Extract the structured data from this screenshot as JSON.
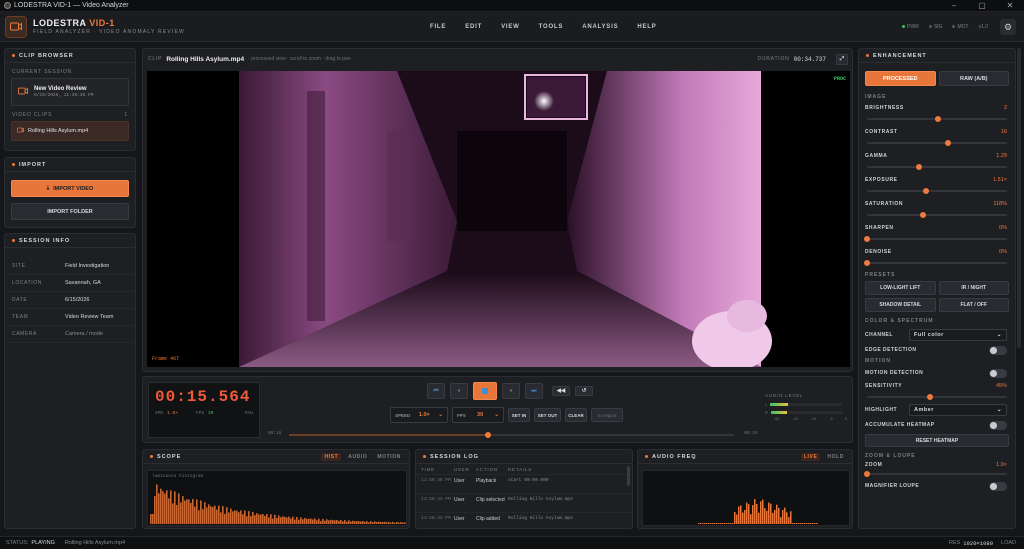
{
  "window": {
    "title": "LODESTRA VID-1 — Video Analyzer"
  },
  "brand": {
    "name": "LODESTRA",
    "model": "VID-1",
    "tagline": "FIELD ANALYZER · VIDEO ANOMALY REVIEW"
  },
  "menu": [
    "FILE",
    "EDIT",
    "VIEW",
    "TOOLS",
    "ANALYSIS",
    "HELP"
  ],
  "indicators": {
    "pwr": "PWR",
    "sig": "SIG",
    "mot": "MOT",
    "version": "v1.0"
  },
  "clip_browser": {
    "title": "CLIP BROWSER",
    "session_label": "CURRENT SESSION",
    "session_name": "New Video Review",
    "session_time": "6/15/2026, 11:36:35 PM",
    "clips_label": "VIDEO CLIPS",
    "clips_count": "1",
    "clips": [
      "Rolling Hills Asylum.mp4"
    ]
  },
  "import": {
    "title": "IMPORT",
    "import_video": "IMPORT VIDEO",
    "import_folder": "IMPORT FOLDER"
  },
  "session_info": {
    "title": "SESSION INFO",
    "rows": [
      {
        "key": "SITE",
        "value": "Field Investigation"
      },
      {
        "key": "LOCATION",
        "value": "Savannah, GA"
      },
      {
        "key": "DATE",
        "value": "6/15/2026"
      },
      {
        "key": "TEAM",
        "value": "Video Review Team"
      },
      {
        "key": "CAMERA",
        "value": "Camera / mode"
      }
    ]
  },
  "video": {
    "clip_label": "CLIP",
    "clip_name": "Rolling Hills Asylum.mp4",
    "hint": "· processed view · scroll to zoom · drag to pan",
    "duration_label": "DURATION",
    "duration": "00:34.737",
    "proc_badge": "PROC",
    "frame_label": "Frame 467"
  },
  "transport": {
    "timecode": "00:15.564",
    "spd_label": "SPD",
    "spd_value": "1.0×",
    "fps_label": "FPS",
    "fps_value": "30",
    "paused_label": "PAU",
    "speed_label": "SPEED",
    "speed_value": "1.0×",
    "fps_select_label": "FPS",
    "fps_select_value": "30",
    "set_in": "SET IN",
    "set_out": "SET OUT",
    "clear": "CLEAR",
    "no_region": "no region",
    "start_time": "00:15",
    "end_time": "00:34",
    "progress": 0.448,
    "audio_level_label": "AUDIO LEVEL",
    "level_l": "L",
    "level_r": "R",
    "level_l_value": 0.24,
    "level_r_value": 0.22,
    "db_ticks": [
      "-60",
      "-40",
      "-20",
      "-6",
      "0"
    ]
  },
  "scope": {
    "title": "SCOPE",
    "tabs": [
      "HIST",
      "AUDIO",
      "MOTION"
    ],
    "active_tab": "HIST",
    "caption": "luminance histogram"
  },
  "session_log": {
    "title": "SESSION LOG",
    "columns": [
      "TIME",
      "USER",
      "ACTION",
      "DETAILS"
    ],
    "rows": [
      {
        "time": "11:56:46 PM",
        "user": "User",
        "action": "Playback",
        "details": "start 00:00.000"
      },
      {
        "time": "11:56:43 PM",
        "user": "User",
        "action": "Clip selected",
        "details": "Rolling Hills Asylum.mp4"
      },
      {
        "time": "11:56:43 PM",
        "user": "User",
        "action": "Clip added",
        "details": "Rolling Hills Asylum.mp4"
      }
    ]
  },
  "audio_freq": {
    "title": "AUDIO FREQ",
    "tabs": [
      "LIVE",
      "HOLD"
    ],
    "active_tab": "LIVE"
  },
  "enhancement": {
    "title": "ENHANCEMENT",
    "mode_processed": "PROCESSED",
    "mode_raw": "RAW (A/B)",
    "image_label": "IMAGE",
    "sliders": [
      {
        "name": "BRIGHTNESS",
        "value": "2",
        "pos": 0.51
      },
      {
        "name": "CONTRAST",
        "value": "16",
        "pos": 0.58
      },
      {
        "name": "GAMMA",
        "value": "1.29",
        "pos": 0.37
      },
      {
        "name": "EXPOSURE",
        "value": "1.51×",
        "pos": 0.42
      },
      {
        "name": "SATURATION",
        "value": "118%",
        "pos": 0.4
      },
      {
        "name": "SHARPEN",
        "value": "0%",
        "pos": 0.0
      },
      {
        "name": "DENOISE",
        "value": "0%",
        "pos": 0.0
      }
    ],
    "presets_label": "PRESETS",
    "presets": [
      "LOW-LIGHT LIFT",
      "IR / NIGHT",
      "SHADOW DETAIL",
      "FLAT / OFF"
    ],
    "color_label": "COLOR & SPECTRUM",
    "channel_label": "CHANNEL",
    "channel_value": "Full color",
    "edge_label": "EDGE DETECTION",
    "motion_label": "MOTION",
    "motion_detect_label": "MOTION DETECTION",
    "sensitivity_label": "SENSITIVITY",
    "sensitivity_value": "45%",
    "sensitivity_pos": 0.45,
    "highlight_label": "HIGHLIGHT",
    "highlight_value": "Amber",
    "heatmap_label": "ACCUMULATE HEATMAP",
    "reset_heatmap": "RESET HEATMAP",
    "zoom_section": "ZOOM & LOUPE",
    "zoom_label": "ZOOM",
    "zoom_value": "1.0×",
    "zoom_pos": 0.0,
    "loupe_label": "MAGNIFIER LOUPE"
  },
  "statusbar": {
    "label": "STATUS:",
    "state": "PLAYING",
    "file": "Rolling Hills Asylum.mp4",
    "res_label": "RES",
    "res_value": "1920×1080",
    "load": "LOAD"
  },
  "colors": {
    "accent": "#ef7a3a",
    "ok": "#3bc06a",
    "panel": "#1e1f23",
    "video_tint": "#b05aa8"
  }
}
